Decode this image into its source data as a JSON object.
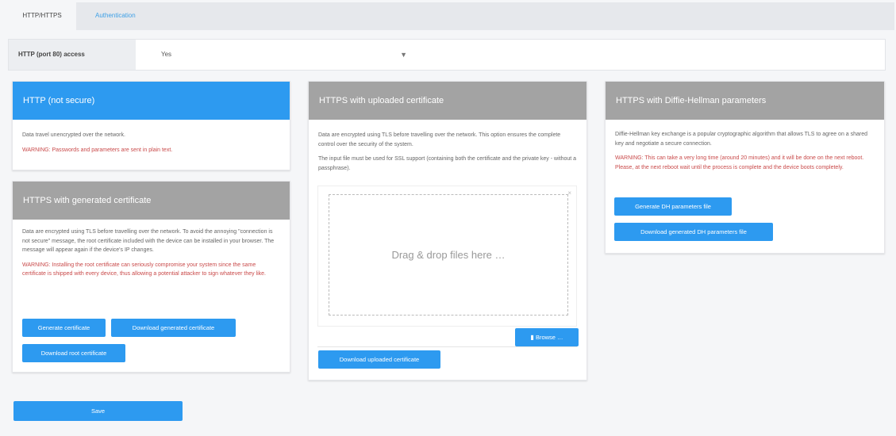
{
  "tabs": [
    {
      "label": "HTTP/HTTPS"
    },
    {
      "label": "Authentication"
    }
  ],
  "access": {
    "label": "HTTP (port 80) access",
    "value": "Yes"
  },
  "http_panel": {
    "title": "HTTP (not secure)",
    "text": "Data travel unencrypted over the network.",
    "warning": "WARNING: Passwords and parameters are sent in plain text."
  },
  "gen_panel": {
    "title": "HTTPS with generated certificate",
    "text": "Data are encrypted using TLS before travelling over the network. To avoid the annoying \"connection is not secure\" message, the root certificate included with the device can be installed in your browser. The message will appear again if the device's IP changes.",
    "warning": "WARNING: Installing the root certificate can seriously compromise your system since the same certificate is shipped with every device, thus allowing a potential attacker to sign whatever they like.",
    "btn_generate": "Generate certificate",
    "btn_download_generated": "Download generated certificate",
    "btn_download_root": "Download root certificate"
  },
  "upload_panel": {
    "title": "HTTPS with uploaded certificate",
    "text1": "Data are encrypted using TLS before travelling over the network. This option ensures the complete control over the security of the system.",
    "text2": "The input file must be used for SSL support (containing both the certificate and the private key - without a passphrase).",
    "drop_text": "Drag & drop files here …",
    "close": "×",
    "btn_browse": "Browse …",
    "btn_download_uploaded": "Download uploaded certificate"
  },
  "dh_panel": {
    "title": "HTTPS with Diffie-Hellman parameters",
    "text": "Diffie-Hellman key exchange is a popular cryptographic algorithm that allows TLS to agree on a shared key and negotiate a secure connection.",
    "warning": "WARNING: This can take a very long time (around 20 minutes) and it will be done on the next reboot. Please, at the next reboot wait until the process is complete and the device boots completely.",
    "btn_generate": "Generate DH parameters file",
    "btn_download": "Download generated DH parameters file"
  },
  "save_label": "Save",
  "colors": {
    "accent": "#2d9af0",
    "header_gray": "#a3a3a3",
    "warning": "#c94a4a"
  }
}
